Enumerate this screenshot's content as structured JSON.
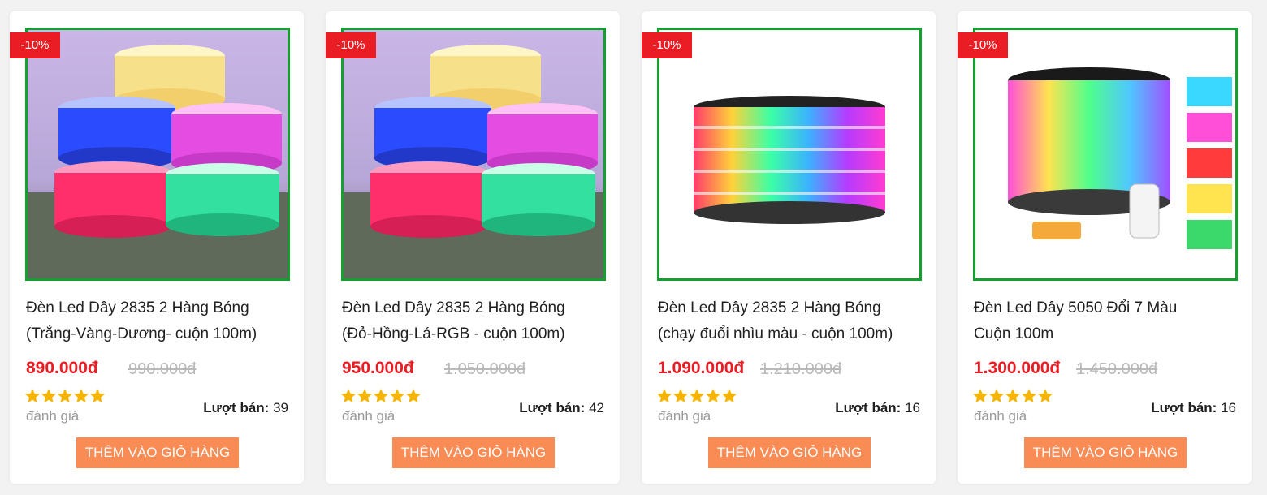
{
  "products": [
    {
      "badge": "-10%",
      "title_line1": "Đèn Led Dây 2835 2 Hàng Bóng",
      "title_line2": "(Trắng-Vàng-Dương- cuộn 100m)",
      "price": "890.000đ",
      "old_price": "990.000đ",
      "rating_stars": 5,
      "rating_label": "đánh giá",
      "sold_label": "Lượt bán:",
      "sold_count": "39",
      "cart_button": "THÊM VÀO GIỎ HÀNG",
      "image_icon": "led-strip-reels-stack-image"
    },
    {
      "badge": "-10%",
      "title_line1": "Đèn Led Dây 2835 2 Hàng Bóng",
      "title_line2": "(Đỏ-Hồng-Lá-RGB - cuộn 100m)",
      "price": "950.000đ",
      "old_price": "1.050.000đ",
      "rating_stars": 5,
      "rating_label": "đánh giá",
      "sold_label": "Lượt bán:",
      "sold_count": "42",
      "cart_button": "THÊM VÀO GIỎ HÀNG",
      "image_icon": "led-strip-reels-stack-image"
    },
    {
      "badge": "-10%",
      "title_line1": "Đèn Led Dây 2835 2 Hàng Bóng",
      "title_line2": "(chạy đuổi nhìu màu - cuộn 100m)",
      "price": "1.090.000đ",
      "old_price": "1.210.000đ",
      "rating_stars": 5,
      "rating_label": "đánh giá",
      "sold_label": "Lượt bán:",
      "sold_count": "16",
      "cart_button": "THÊM VÀO GIỎ HÀNG",
      "image_icon": "led-strip-reel-multicolor-image"
    },
    {
      "badge": "-10%",
      "title_line1": "Đèn Led Dây 5050 Đổi 7 Màu",
      "title_line2": "Cuộn 100m",
      "price": "1.300.000đ",
      "old_price": "1.450.000đ",
      "rating_stars": 5,
      "rating_label": "đánh giá",
      "sold_label": "Lượt bán:",
      "sold_count": "16",
      "cart_button": "THÊM VÀO GIỎ HÀNG",
      "image_icon": "led-strip-rgb-reel-remote-image"
    }
  ],
  "colors": {
    "badge": "#ea1c24",
    "price": "#ea1c24",
    "border": "#14a02e",
    "button": "#f98b54",
    "star": "#f7b500"
  }
}
